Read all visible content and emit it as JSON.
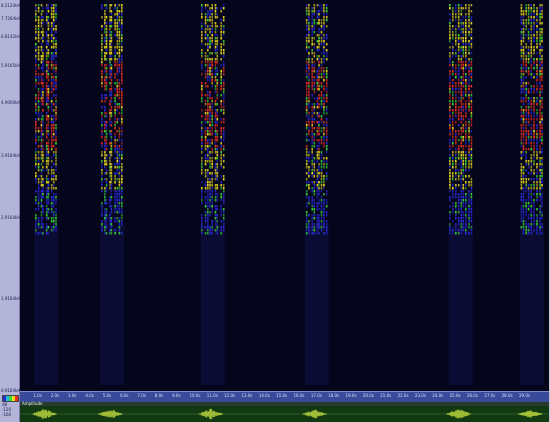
{
  "frequency_axis": {
    "ticks": [
      "8.2120kHz",
      "7.7264kHz",
      "6.8142kHz",
      "5.9165kHz",
      "4.9000kHz",
      "3.9164kHz",
      "2.9164kHz",
      "1.9164kHz",
      "0.9164kHz"
    ]
  },
  "time_axis": {
    "ticks": [
      "1.0s",
      "2.0s",
      "3.0s",
      "4.0s",
      "5.0s",
      "6.0s",
      "7.0s",
      "8.0s",
      "9.0s",
      "10.0s",
      "11.0s",
      "12.0s",
      "13.0s",
      "14.0s",
      "15.0s",
      "16.0s",
      "17.0s",
      "18.0s",
      "19.0s",
      "20.0s",
      "21.0s",
      "22.0s",
      "23.0s",
      "24.0s",
      "25.0s",
      "26.0s",
      "27.0s",
      "28.0s",
      "29.0s",
      "30.0s"
    ]
  },
  "waveform_panel": {
    "title": "Amplitude"
  },
  "legend": {
    "db_top": "dB",
    "db_values": [
      "-120",
      "-160"
    ]
  },
  "colors": {
    "background": "#05061c",
    "low": "#2a2ad8",
    "mid": "#38d838",
    "high": "#e83020",
    "waveform": "#c8e040"
  },
  "spectrogram_bursts": [
    {
      "time_s": 1.4,
      "intensity": 0.95
    },
    {
      "time_s": 5.2,
      "intensity": 0.9
    },
    {
      "time_s": 11.0,
      "intensity": 0.9
    },
    {
      "time_s": 17.0,
      "intensity": 0.8
    },
    {
      "time_s": 25.3,
      "intensity": 0.95
    },
    {
      "time_s": 29.4,
      "intensity": 0.9
    }
  ]
}
